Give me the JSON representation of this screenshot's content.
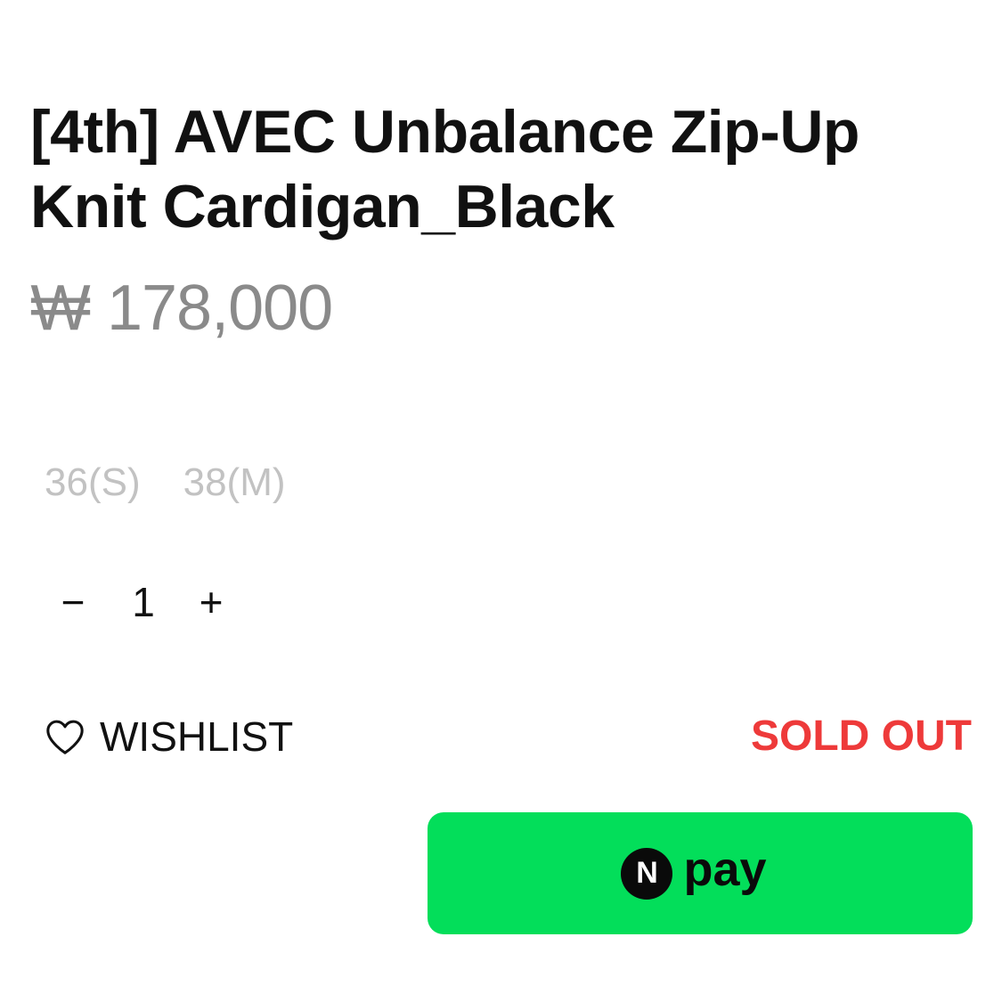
{
  "product": {
    "title": "[4th] AVEC Unbalance Zip-Up Knit Cardigan_Black",
    "price": "₩ 178,000"
  },
  "sizes": [
    "36(S)",
    "38(M)"
  ],
  "quantity": {
    "decrement": "−",
    "value": "1",
    "increment": "+"
  },
  "wishlist": {
    "icon": "heart-outline-icon",
    "label": "WISHLIST"
  },
  "status": {
    "label": "SOLD OUT",
    "color": "#ee3a3a"
  },
  "npay": {
    "badge": "N",
    "label": "pay",
    "color": "#03de5a"
  }
}
